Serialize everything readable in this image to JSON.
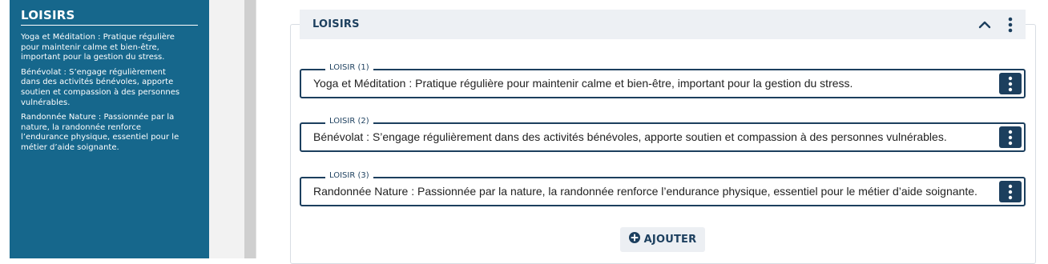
{
  "preview": {
    "title": "LOISIRS",
    "items": [
      "Yoga et Méditation : Pratique régulière pour maintenir calme et bien-être, important pour la gestion du stress.",
      "Bénévolat : S’engage régulièrement dans des activités bénévoles, apporte soutien et compassion à des personnes vulnérables.",
      "Randonnée Nature : Passionnée par la nature, la randonnée renforce l’endurance physique, essentiel pour le métier d’aide soignante."
    ]
  },
  "section": {
    "title": "LOISIRS",
    "fields": [
      {
        "label": "LOISIR (1)",
        "value": "Yoga et Méditation : Pratique régulière pour maintenir calme et bien-être, important pour la gestion du stress."
      },
      {
        "label": "LOISIR (2)",
        "value": "Bénévolat : S’engage régulièrement dans des activités bénévoles, apporte soutien et compassion à des personnes vulnérables."
      },
      {
        "label": "LOISIR (3)",
        "value": "Randonnée Nature : Passionnée par la nature, la randonnée renforce l’endurance physique, essentiel pour le métier d’aide soignante."
      }
    ],
    "add_label": "AJOUTER"
  },
  "icons": {
    "collapse": "chevron-up-icon",
    "section_menu": "kebab-menu-icon",
    "field_menu": "kebab-menu-icon",
    "add": "plus-circle-icon"
  },
  "colors": {
    "preview_bg": "#16678c",
    "accent": "#1c3f5e",
    "header_bg": "#edf0f4"
  }
}
